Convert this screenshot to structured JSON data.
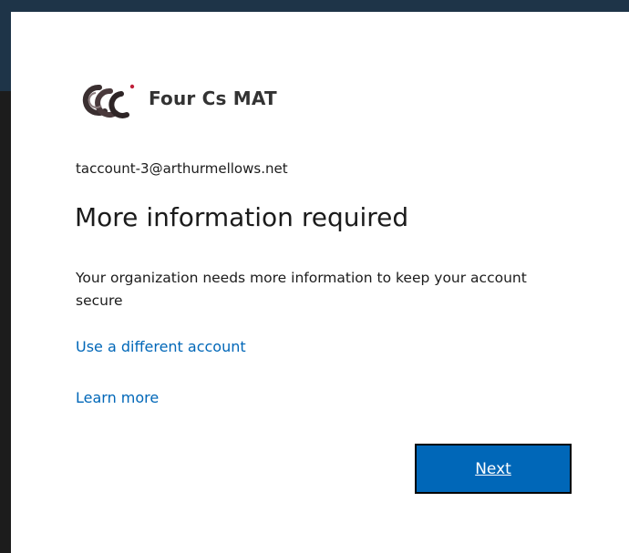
{
  "brand": {
    "name": "Four Cs MAT",
    "logo_icon": "four-cs-logo-icon",
    "colors": {
      "logo_dark": "#3a2f30",
      "logo_accent": "#c0203a"
    }
  },
  "identity": {
    "email": "taccount-3@arthurmellows.net"
  },
  "title": "More information required",
  "description": "Your organization needs more information to keep your account secure",
  "links": {
    "use_different_account": "Use a different account",
    "learn_more": "Learn more"
  },
  "buttons": {
    "next": "Next"
  },
  "colors": {
    "primary": "#0067b8",
    "link": "#0067b8",
    "text": "#1b1b1b",
    "backdrop": "#1e3448"
  }
}
